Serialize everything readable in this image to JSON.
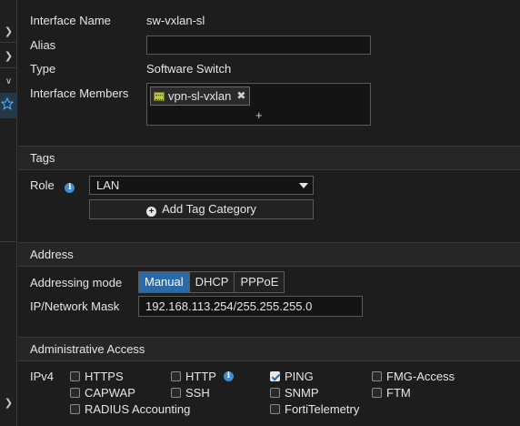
{
  "interface": {
    "name_label": "Interface Name",
    "name_value": "sw-vxlan-sl",
    "alias_label": "Alias",
    "alias_value": "",
    "type_label": "Type",
    "type_value": "Software Switch",
    "members_label": "Interface Members",
    "members": [
      {
        "name": "vpn-sl-vxlan",
        "icon": "vpn-tunnel-icon"
      }
    ],
    "add_member_symbol": "+"
  },
  "tags": {
    "section_title": "Tags",
    "role_label": "Role",
    "role_value": "LAN",
    "add_tag_label": "Add Tag Category"
  },
  "address": {
    "section_title": "Address",
    "mode_label": "Addressing mode",
    "modes": [
      "Manual",
      "DHCP",
      "PPPoE"
    ],
    "active_mode": "Manual",
    "ip_label": "IP/Network Mask",
    "ip_value": "192.168.113.254/255.255.255.0"
  },
  "admin": {
    "section_title": "Administrative Access",
    "ipv4_label": "IPv4",
    "options": [
      {
        "label": "HTTPS",
        "checked": false
      },
      {
        "label": "HTTP",
        "checked": false,
        "info": true
      },
      {
        "label": "PING",
        "checked": true
      },
      {
        "label": "FMG-Access",
        "checked": false
      },
      {
        "label": "CAPWAP",
        "checked": false
      },
      {
        "label": "SSH",
        "checked": false
      },
      {
        "label": "SNMP",
        "checked": false
      },
      {
        "label": "FTM",
        "checked": false
      },
      {
        "label": "RADIUS Accounting",
        "checked": false
      },
      {
        "label": "FortiTelemetry",
        "checked": false
      }
    ]
  },
  "colors": {
    "accent": "#2a6aa8",
    "info": "#3c8fd6",
    "background": "#1d1d1d"
  }
}
